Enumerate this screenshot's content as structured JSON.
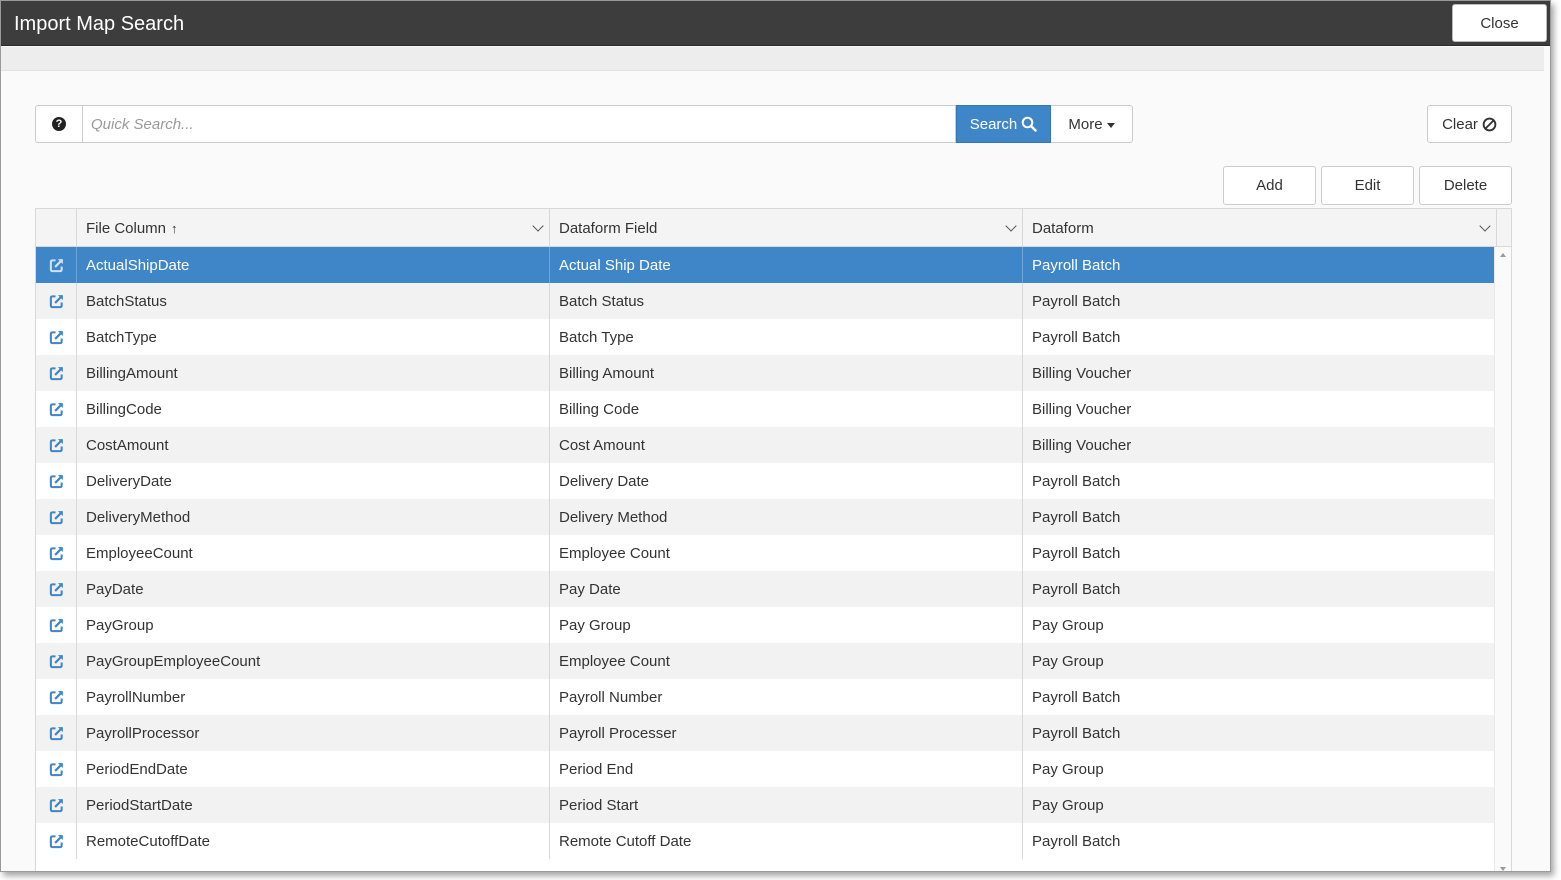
{
  "window": {
    "title": "Import Map Search",
    "close_label": "Close"
  },
  "search": {
    "placeholder": "Quick Search...",
    "search_label": "Search",
    "more_label": "More",
    "clear_label": "Clear",
    "help_icon": "question-circle-icon",
    "search_icon": "magnifier-icon",
    "clear_icon": "ban-icon"
  },
  "actions": {
    "add_label": "Add",
    "edit_label": "Edit",
    "delete_label": "Delete"
  },
  "grid": {
    "columns": [
      {
        "label": "File Column",
        "sorted": "ascending"
      },
      {
        "label": "Dataform Field"
      },
      {
        "label": "Dataform"
      }
    ],
    "row_icon": "external-link-icon",
    "selected_index": 0,
    "rows": [
      {
        "file_column": "ActualShipDate",
        "dataform_field": "Actual Ship Date",
        "dataform": "Payroll Batch"
      },
      {
        "file_column": "BatchStatus",
        "dataform_field": "Batch Status",
        "dataform": "Payroll Batch"
      },
      {
        "file_column": "BatchType",
        "dataform_field": "Batch Type",
        "dataform": "Payroll Batch"
      },
      {
        "file_column": "BillingAmount",
        "dataform_field": "Billing Amount",
        "dataform": "Billing Voucher"
      },
      {
        "file_column": "BillingCode",
        "dataform_field": "Billing Code",
        "dataform": "Billing Voucher"
      },
      {
        "file_column": "CostAmount",
        "dataform_field": "Cost Amount",
        "dataform": "Billing Voucher"
      },
      {
        "file_column": "DeliveryDate",
        "dataform_field": "Delivery Date",
        "dataform": "Payroll Batch"
      },
      {
        "file_column": "DeliveryMethod",
        "dataform_field": "Delivery Method",
        "dataform": "Payroll Batch"
      },
      {
        "file_column": "EmployeeCount",
        "dataform_field": "Employee Count",
        "dataform": "Payroll Batch"
      },
      {
        "file_column": "PayDate",
        "dataform_field": "Pay Date",
        "dataform": "Payroll Batch"
      },
      {
        "file_column": "PayGroup",
        "dataform_field": "Pay Group",
        "dataform": "Pay Group"
      },
      {
        "file_column": "PayGroupEmployeeCount",
        "dataform_field": "Employee Count",
        "dataform": "Pay Group"
      },
      {
        "file_column": "PayrollNumber",
        "dataform_field": "Payroll Number",
        "dataform": "Payroll Batch"
      },
      {
        "file_column": "PayrollProcessor",
        "dataform_field": "Payroll Processer",
        "dataform": "Payroll Batch"
      },
      {
        "file_column": "PeriodEndDate",
        "dataform_field": "Period End",
        "dataform": "Pay Group"
      },
      {
        "file_column": "PeriodStartDate",
        "dataform_field": "Period Start",
        "dataform": "Pay Group"
      },
      {
        "file_column": "RemoteCutoffDate",
        "dataform_field": "Remote Cutoff Date",
        "dataform": "Payroll Batch"
      }
    ]
  },
  "colors": {
    "accent": "#3f86c8",
    "titlebar": "#3d3d3d",
    "row_alt": "#f2f2f2"
  }
}
